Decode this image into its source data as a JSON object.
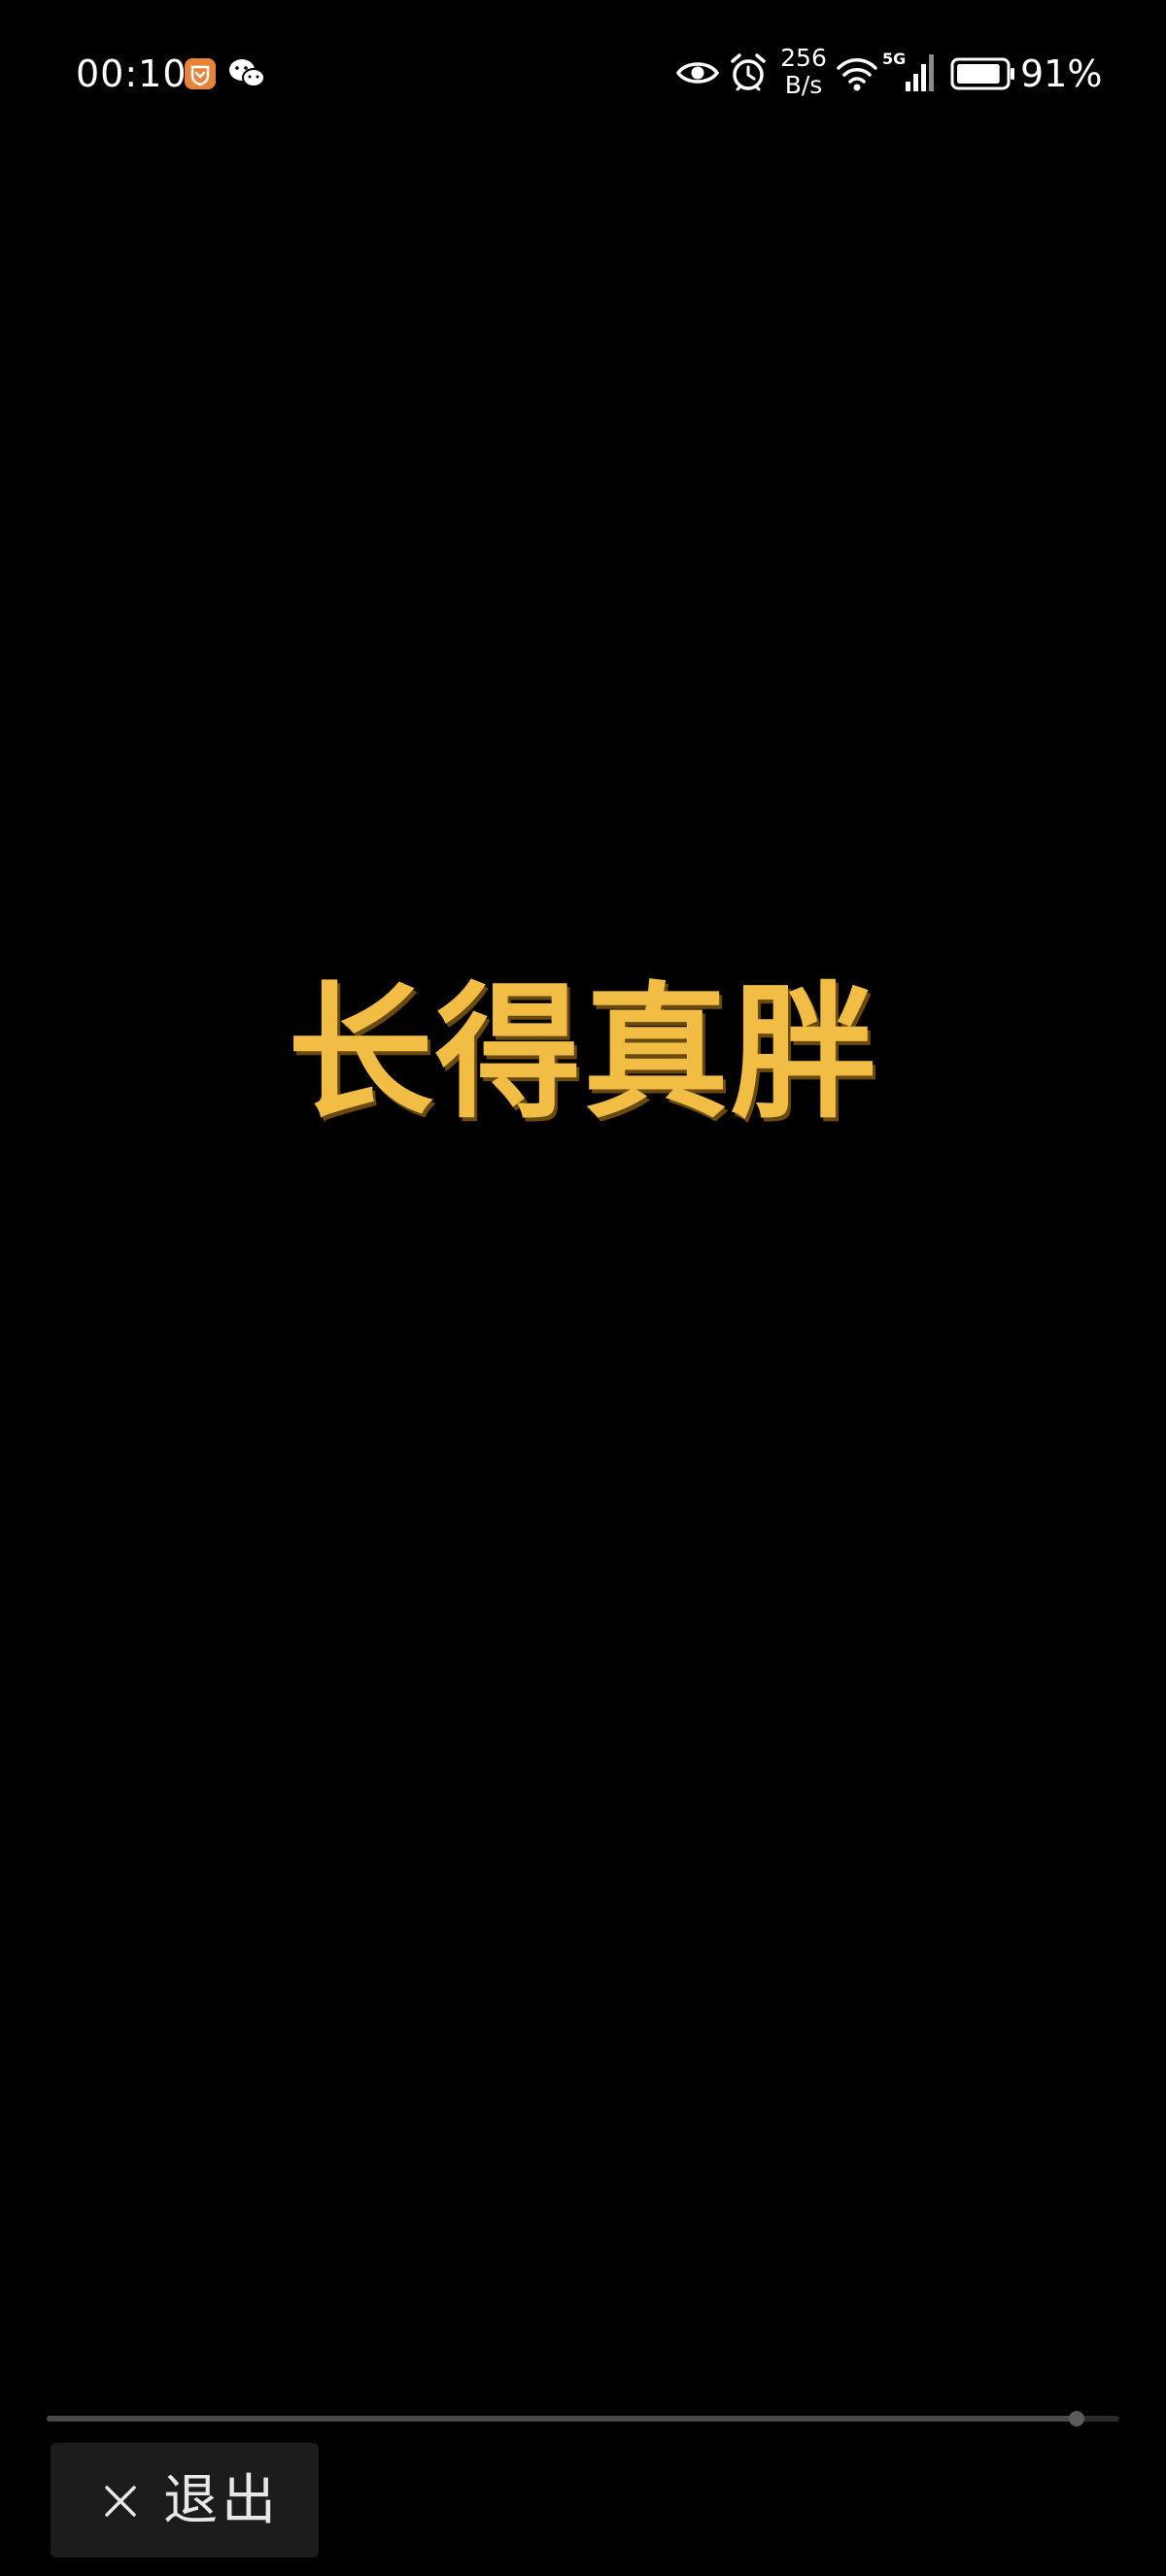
{
  "status_bar": {
    "time": "00:10",
    "net_speed_value": "256",
    "net_speed_unit": "B/s",
    "network_type": "5G",
    "battery_percent_label": "91%",
    "battery_fraction": 0.91,
    "icons": [
      "app-notification-icon",
      "wechat-icon",
      "eye-icon",
      "alarm-icon",
      "wifi-icon",
      "signal-icon",
      "battery-icon"
    ]
  },
  "video": {
    "caption": "长得真胖",
    "caption_color": "#f2bd45",
    "background": "#000000",
    "progress_fraction": 0.96
  },
  "exit_button": {
    "icon": "close-icon",
    "label": "退出"
  }
}
